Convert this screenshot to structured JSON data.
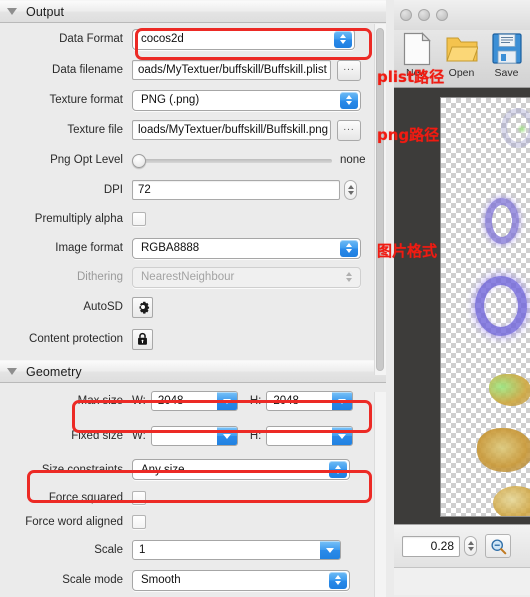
{
  "inspector": {
    "sections": [
      {
        "title": "Output",
        "rows": [
          {
            "label": "Data Format",
            "value": "cocos2d"
          },
          {
            "label": "Data filename",
            "value": "oads/MyTextuer/buffskill/Buffskill.plist",
            "browse": "..."
          },
          {
            "label": "Texture format",
            "value": "PNG (.png)"
          },
          {
            "label": "Texture file",
            "value": "loads/MyTextuer/buffskill/Buffskill.png",
            "browse": "..."
          },
          {
            "label": "Png Opt Level",
            "value": "none"
          },
          {
            "label": "DPI",
            "value": "72"
          },
          {
            "label": "Premultiply alpha",
            "value": ""
          },
          {
            "label": "Image format",
            "value": "RGBA8888"
          },
          {
            "label": "Dithering",
            "value": "NearestNeighbour"
          },
          {
            "label": "AutoSD",
            "value": ""
          },
          {
            "label": "Content protection",
            "value": ""
          }
        ]
      },
      {
        "title": "Geometry",
        "rows": [
          {
            "label": "Max size",
            "w_label": "W:",
            "w_value": "2048",
            "h_label": "H:",
            "h_value": "2048"
          },
          {
            "label": "Fixed size",
            "w_label": "W:",
            "w_value": "",
            "h_label": "H:",
            "h_value": ""
          },
          {
            "label": "Size constraints",
            "value": "Any size"
          },
          {
            "label": "Force squared",
            "value": ""
          },
          {
            "label": "Force word aligned",
            "value": ""
          },
          {
            "label": "Scale",
            "value": "1"
          },
          {
            "label": "Scale mode",
            "value": "Smooth"
          }
        ]
      }
    ]
  },
  "window": {
    "toolbar": [
      {
        "label": "New",
        "icon": "new-document-icon"
      },
      {
        "label": "Open",
        "icon": "open-folder-icon"
      },
      {
        "label": "Save",
        "icon": "floppy-disk-icon"
      }
    ],
    "zoom_value": "0.28",
    "zoom_icon": "magnifier-icon"
  },
  "annotations": [
    {
      "text": "plist路径",
      "target": "data-filename-row"
    },
    {
      "text": "png路径",
      "target": "texture-file-row"
    },
    {
      "text": "图片格式",
      "target": "image-format-row"
    }
  ],
  "colors": {
    "annotation_red": "#f01b12",
    "highlight_box_red": "#ec2a25",
    "panel_bg": "#ebebeb",
    "preview_bg": "#3d3c3a",
    "popup_blue": "#2a8ae9"
  }
}
